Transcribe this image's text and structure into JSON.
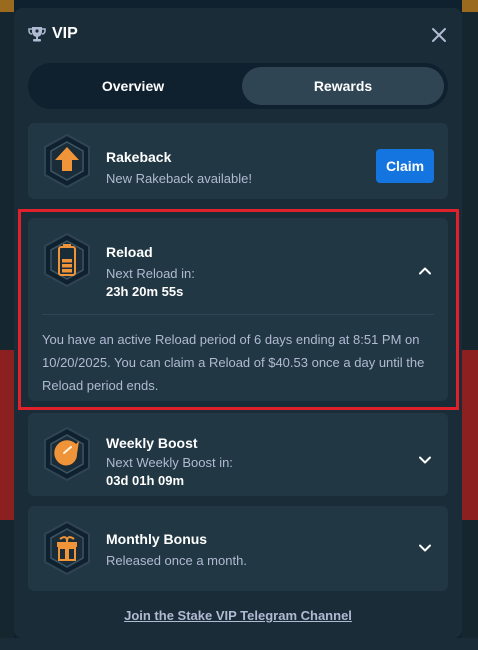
{
  "header": {
    "title": "VIP"
  },
  "tabs": [
    {
      "label": "Overview",
      "active": false
    },
    {
      "label": "Rewards",
      "active": true
    }
  ],
  "rewards": {
    "rakeback": {
      "title": "Rakeback",
      "subtitle": "New Rakeback available!",
      "button": "Claim",
      "icon": "arrow-up-hex-icon"
    },
    "reload": {
      "title": "Reload",
      "subtitle": "Next Reload in:",
      "countdown": "23h 20m 55s",
      "description": "You have an active Reload period of 6 days ending at 8:51 PM on 10/20/2025. You can claim a Reload of $40.53 once a day until the Reload period ends.",
      "expanded": true,
      "icon": "battery-hex-icon"
    },
    "weekly_boost": {
      "title": "Weekly Boost",
      "subtitle": "Next Weekly Boost in:",
      "countdown": "03d 01h 09m",
      "icon": "rocket-hex-icon"
    },
    "monthly_bonus": {
      "title": "Monthly Bonus",
      "subtitle": "Released once a month.",
      "icon": "gift-hex-icon"
    }
  },
  "footer": {
    "link": "Join the Stake VIP Telegram Channel"
  },
  "colors": {
    "modal_bg": "#1a2c38",
    "card_bg": "#213743",
    "accent_blue": "#1475e1",
    "icon_orange": "#f0943a",
    "highlight_red": "#e0202a"
  }
}
